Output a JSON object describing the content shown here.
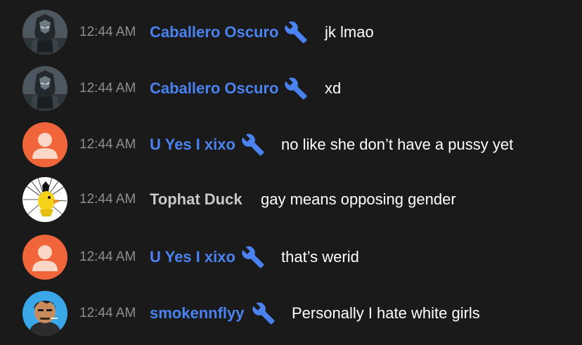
{
  "colors": {
    "background": "#1a1a1a",
    "moderator_name": "#4a82f0",
    "regular_name": "#c8c8c8",
    "timestamp": "#8e8e8e",
    "message_text": "#ffffff",
    "default_avatar": "#f0663a"
  },
  "messages": [
    {
      "time": "12:44 AM",
      "author": "Caballero Oscuro",
      "badge": "wrench-icon",
      "text": "jk lmao",
      "avatar": "dark-knight-avatar"
    },
    {
      "time": "12:44 AM",
      "author": "Caballero Oscuro",
      "badge": "wrench-icon",
      "text": "xd",
      "avatar": "dark-knight-avatar"
    },
    {
      "time": "12:44 AM",
      "author": "U Yes I xixo",
      "badge": "wrench-icon",
      "text": "no like she don’t have a pussy yet",
      "avatar": "default-person-avatar"
    },
    {
      "time": "12:44 AM",
      "author": "Tophat Duck",
      "badge": "",
      "text": "gay means opposing gender",
      "avatar": "yellow-duck-avatar"
    },
    {
      "time": "12:44 AM",
      "author": "U Yes I xixo",
      "badge": "wrench-icon",
      "text": "that’s werid",
      "avatar": "default-person-avatar"
    },
    {
      "time": "12:44 AM",
      "author": "smokennflyy",
      "badge": "wrench-icon",
      "text": "Personally I hate white girls",
      "avatar": "cartoon-boy-avatar"
    }
  ]
}
